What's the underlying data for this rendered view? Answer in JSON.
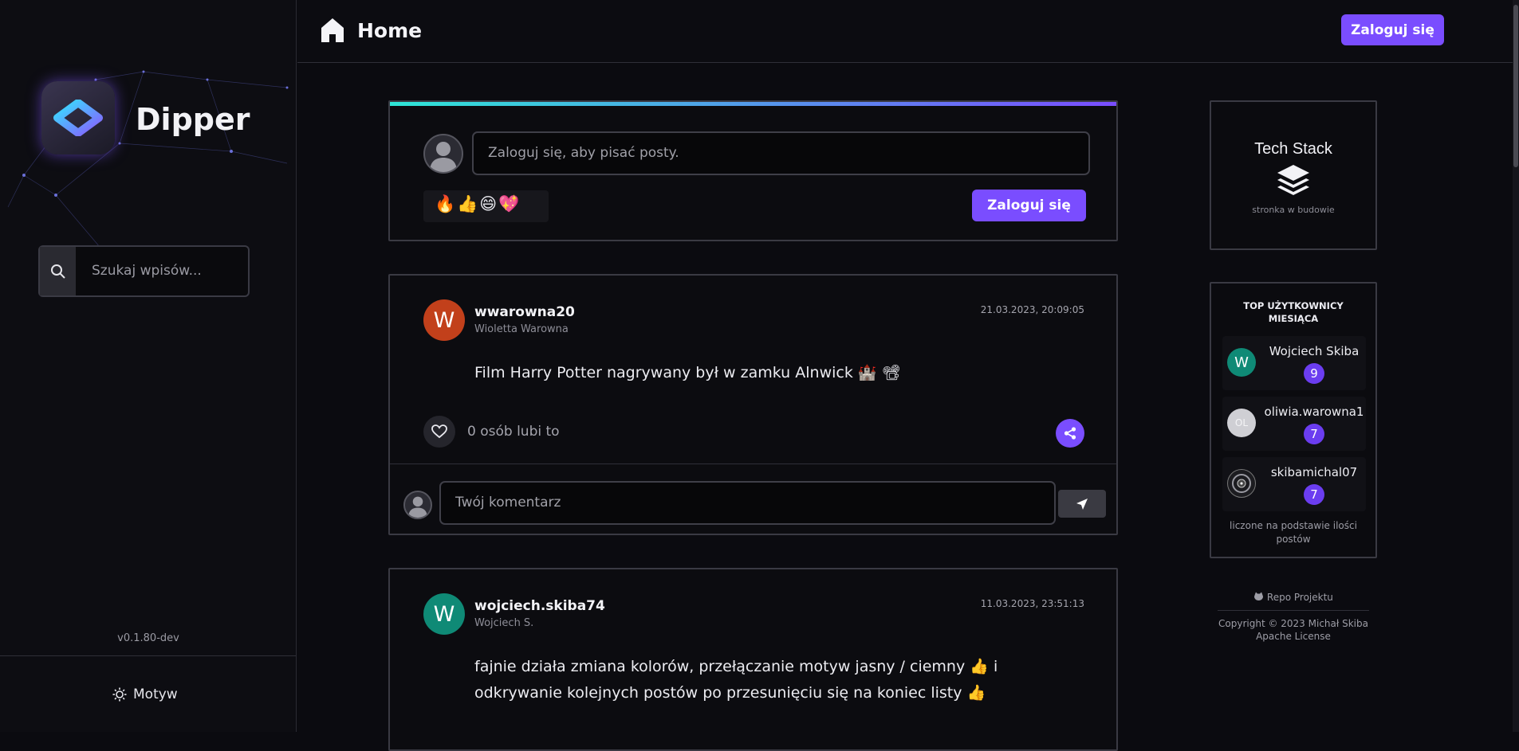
{
  "app": {
    "name": "Dipper",
    "version": "v0.1.80-dev",
    "accent": "#7a4dff"
  },
  "sidebar": {
    "search_placeholder": "Szukaj wpisów...",
    "theme_label": "Motyw"
  },
  "header": {
    "title": "Home",
    "login_label": "Zaloguj się"
  },
  "composer": {
    "placeholder": "Zaloguj się, aby pisać posty.",
    "emojis": "🔥👍😄💖",
    "login_label": "Zaloguj się"
  },
  "posts": [
    {
      "avatar_letter": "W",
      "avatar_color": "#c2401b",
      "username": "wwarowna20",
      "fullname": "Wioletta Warowna",
      "date": "21.03.2023, 20:09:05",
      "content": "Film Harry Potter nagrywany był w zamku Alnwick 🏰 📽",
      "likes": "0 osób lubi to",
      "comment_placeholder": "Twój komentarz"
    },
    {
      "avatar_letter": "W",
      "avatar_color": "#0f8a76",
      "username": "wojciech.skiba74",
      "fullname": "Wojciech S.",
      "date": "11.03.2023, 23:51:13",
      "content": "fajnie działa zmiana kolorów, przełączanie motyw jasny / ciemny 👍 i odkrywanie kolejnych postów po przesunięciu się na koniec listy 👍"
    }
  ],
  "tech_stack": {
    "title": "Tech Stack",
    "subtitle": "stronka w budowie"
  },
  "top_users": {
    "title": "TOP UŻYTKOWNICY MIESIĄCA",
    "users": [
      {
        "avatar": "W",
        "avatar_color": "#0f8a76",
        "name": "Wojciech Skiba",
        "count": "9"
      },
      {
        "avatar": "OL",
        "avatar_color": "#cfcfd4",
        "name": "oliwia.warowna1",
        "count": "7"
      },
      {
        "avatar": "",
        "avatar_color": "#1c1c20",
        "name": "skibamichal07",
        "count": "7"
      }
    ],
    "note": "liczone na podstawie ilości postów"
  },
  "footer": {
    "repo": "Repo Projektu",
    "copyright": "Copyright © 2023 Michał Skiba",
    "license": "Apache License"
  }
}
